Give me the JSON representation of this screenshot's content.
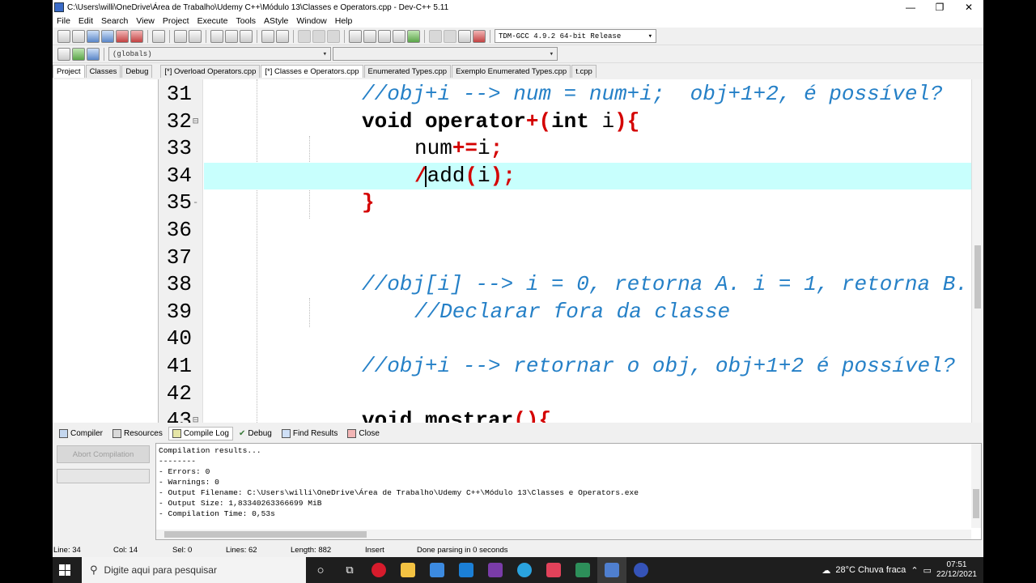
{
  "window": {
    "title": "C:\\Users\\willi\\OneDrive\\Área de Trabalho\\Udemy C++\\Módulo 13\\Classes e Operators.cpp - Dev-C++ 5.11"
  },
  "menu": [
    "File",
    "Edit",
    "Search",
    "View",
    "Project",
    "Execute",
    "Tools",
    "AStyle",
    "Window",
    "Help"
  ],
  "toolbar": {
    "compiler_select": "TDM-GCC 4.9.2 64-bit Release",
    "scope_select": "(globals)"
  },
  "left_tabs": [
    "Project",
    "Classes",
    "Debug"
  ],
  "file_tabs": [
    {
      "label": "[*] Overload Operators.cpp",
      "active": false
    },
    {
      "label": "[*] Classes e Operators.cpp",
      "active": true
    },
    {
      "label": "Enumerated Types.cpp",
      "active": false
    },
    {
      "label": "Exemplo Enumerated Types.cpp",
      "active": false
    },
    {
      "label": "t.cpp",
      "active": false
    }
  ],
  "editor": {
    "lines": [
      {
        "num": "31",
        "indent": 1,
        "tokens": [
          [
            "cm",
            "//obj+i --> num = num+i;  obj+1+2, é possível?"
          ]
        ]
      },
      {
        "num": "32",
        "indent": 1,
        "fold": "⊟",
        "tokens": [
          [
            "kw",
            "void operator"
          ],
          [
            "op",
            "+("
          ],
          [
            "kw",
            "int"
          ],
          [
            "pl",
            " i"
          ],
          [
            "op",
            "){"
          ]
        ]
      },
      {
        "num": "33",
        "indent": 2,
        "tokens": [
          [
            "pl",
            "num"
          ],
          [
            "op",
            "+="
          ],
          [
            "pl",
            "i"
          ],
          [
            "op",
            ";"
          ]
        ]
      },
      {
        "num": "34",
        "indent": 2,
        "highlight": true,
        "tokens": [
          [
            "op",
            "/"
          ],
          [
            "pl",
            "add"
          ],
          [
            "op",
            "("
          ],
          [
            "pl",
            "i"
          ],
          [
            "op",
            ");"
          ]
        ]
      },
      {
        "num": "35",
        "indent": 1,
        "fold": "-",
        "tokens": [
          [
            "op",
            "}"
          ]
        ]
      },
      {
        "num": "36",
        "indent": 0,
        "tokens": []
      },
      {
        "num": "37",
        "indent": 0,
        "tokens": []
      },
      {
        "num": "38",
        "indent": 1,
        "tokens": [
          [
            "cm",
            "//obj[i] --> i = 0, retorna A. i = 1, retorna B."
          ]
        ]
      },
      {
        "num": "39",
        "indent": 2,
        "tokens": [
          [
            "cm",
            "//Declarar fora da classe"
          ]
        ]
      },
      {
        "num": "40",
        "indent": 0,
        "tokens": []
      },
      {
        "num": "41",
        "indent": 1,
        "tokens": [
          [
            "cm",
            "//obj+i --> retornar o obj, obj+1+2 é possível?"
          ]
        ]
      },
      {
        "num": "42",
        "indent": 0,
        "tokens": []
      },
      {
        "num": "43",
        "indent": 1,
        "fold": "⊟",
        "tokens": [
          [
            "kw",
            "void mostrar"
          ],
          [
            "op",
            "(){"
          ]
        ]
      }
    ]
  },
  "bottom_tabs": [
    "Compiler",
    "Resources",
    "Compile Log",
    "Debug",
    "Find Results",
    "Close"
  ],
  "abort_button": "Abort Compilation",
  "compile_log": [
    "Compilation results...",
    "--------",
    "- Errors: 0",
    "- Warnings: 0",
    "- Output Filename: C:\\Users\\willi\\OneDrive\\Área de Trabalho\\Udemy C++\\Módulo 13\\Classes e Operators.exe",
    "- Output Size: 1,83340263366699 MiB",
    "- Compilation Time: 0,53s"
  ],
  "status": {
    "line": "Line:   34",
    "col": "Col:   14",
    "sel": "Sel:   0",
    "lines": "Lines:   62",
    "length": "Length:   882",
    "mode": "Insert",
    "message": "Done parsing in 0 seconds"
  },
  "taskbar": {
    "search_placeholder": "Digite aqui para pesquisar",
    "weather": "28°C  Chuva fraca",
    "time": "07:51",
    "date": "22/12/2021"
  },
  "colors": {
    "comment": "#2580c7",
    "operator": "#d40000",
    "highlight_line": "#c8fffd"
  }
}
